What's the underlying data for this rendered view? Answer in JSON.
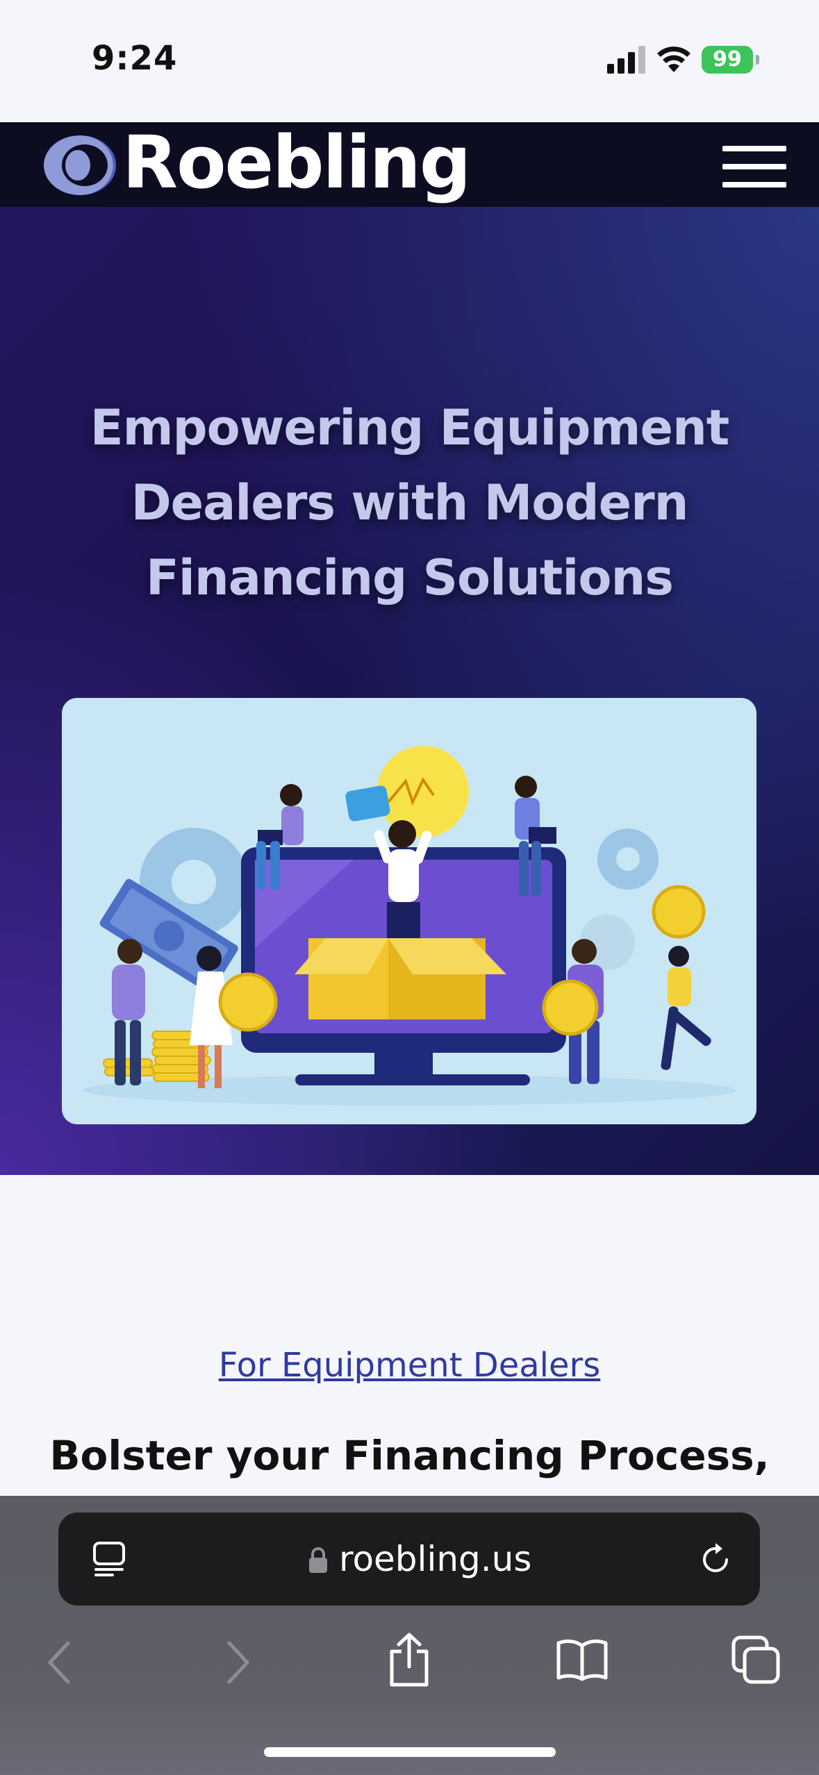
{
  "status_bar": {
    "time": "9:24",
    "battery": "99"
  },
  "header": {
    "brand": "Roebling",
    "menu_icon": "hamburger-menu-icon"
  },
  "hero": {
    "title_lines": [
      "Empowering Equipment",
      "Dealers with Modern",
      "Financing Solutions"
    ]
  },
  "content": {
    "dealers_link": "For Equipment Dealers",
    "heading": "Bolster your Financing Process,"
  },
  "browser": {
    "url": "roebling.us",
    "icons": [
      "reader-mode-icon",
      "lock-icon",
      "reload-icon",
      "back-icon",
      "forward-icon",
      "share-icon",
      "bookmarks-icon",
      "tabs-icon"
    ]
  },
  "colors": {
    "accent": "#2f3aa0",
    "header_bg": "#0d0d22",
    "battery": "#3cc45a"
  }
}
